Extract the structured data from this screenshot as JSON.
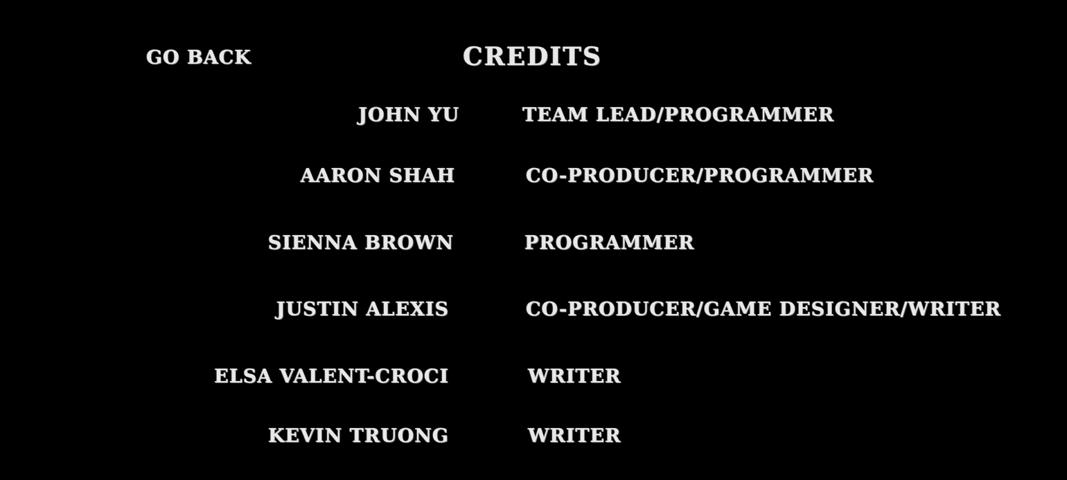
{
  "screen": {
    "title": "CREDITS",
    "go_back_label": "GO BACK",
    "background_color": "#000000",
    "text_color": "#e8e8e8"
  },
  "credits": [
    {
      "name": "JOHN YU",
      "role": "TEAM LEAD/PROGRAMMER"
    },
    {
      "name": "AARON SHAH",
      "role": "CO-PRODUCER/PROGRAMMER"
    },
    {
      "name": "SIENNA BROWN",
      "role": "PROGRAMMER"
    },
    {
      "name": "JUSTIN ALEXIS",
      "role": "CO-PRODUCER/GAME DESIGNER/WRITER"
    },
    {
      "name": "ELSA VALENT-CROCI",
      "role": "WRITER"
    },
    {
      "name": "KEVIN TRUONG",
      "role": "WRITER"
    }
  ]
}
